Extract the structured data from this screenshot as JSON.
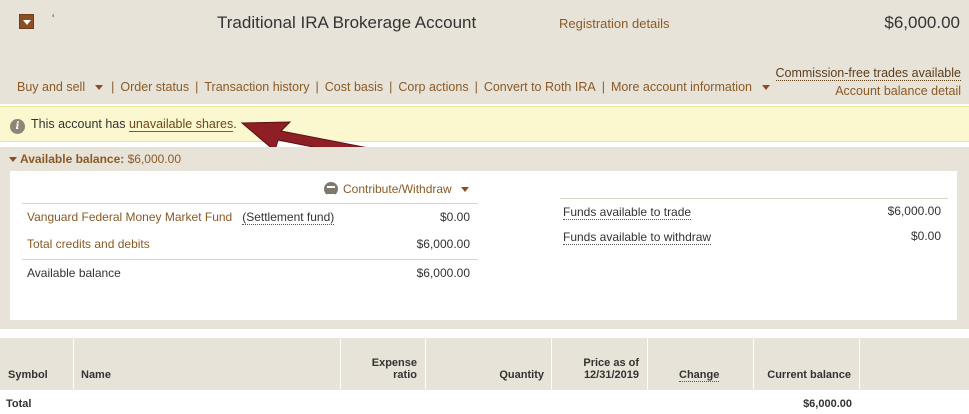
{
  "header": {
    "mark": "'",
    "title": "Traditional IRA Brokerage Account",
    "registration_link": "Registration details",
    "total": "$6,000.00",
    "nav": [
      "Buy and sell",
      "Order status",
      "Transaction history",
      "Cost basis",
      "Corp actions",
      "Convert to Roth IRA",
      "More account information"
    ],
    "commission_link": "Commission-free trades available",
    "balance_detail_link": "Account balance detail"
  },
  "alert": {
    "prefix": "This account has",
    "link": "unavailable shares",
    "suffix": "."
  },
  "available": {
    "label": "Available balance:",
    "value": "$6,000.00",
    "contribute_label": "Contribute/Withdraw",
    "left_rows": [
      {
        "label": "Vanguard Federal Money Market Fund",
        "sub": "(Settlement fund)",
        "amount": "$0.00"
      },
      {
        "label": "Total credits and debits",
        "amount": "$6,000.00"
      },
      {
        "label": "Available balance",
        "amount": "$6,000.00"
      }
    ],
    "right_rows": [
      {
        "label": "Funds available to trade",
        "amount": "$6,000.00"
      },
      {
        "label": "Funds available to withdraw",
        "amount": "$0.00"
      }
    ]
  },
  "holdings": {
    "headers": {
      "symbol": "Symbol",
      "name": "Name",
      "expense_1": "Expense",
      "expense_2": "ratio",
      "quantity": "Quantity",
      "price_1": "Price as of",
      "price_2": "12/31/2019",
      "change": "Change",
      "current_balance": "Current balance"
    },
    "total_label": "Total",
    "total_value": "$6,000.00"
  },
  "colors": {
    "band": "#e8e3d8",
    "link": "#8a5a26",
    "alert_bg": "#fbf7cf",
    "arrow": "#8e1f24"
  }
}
